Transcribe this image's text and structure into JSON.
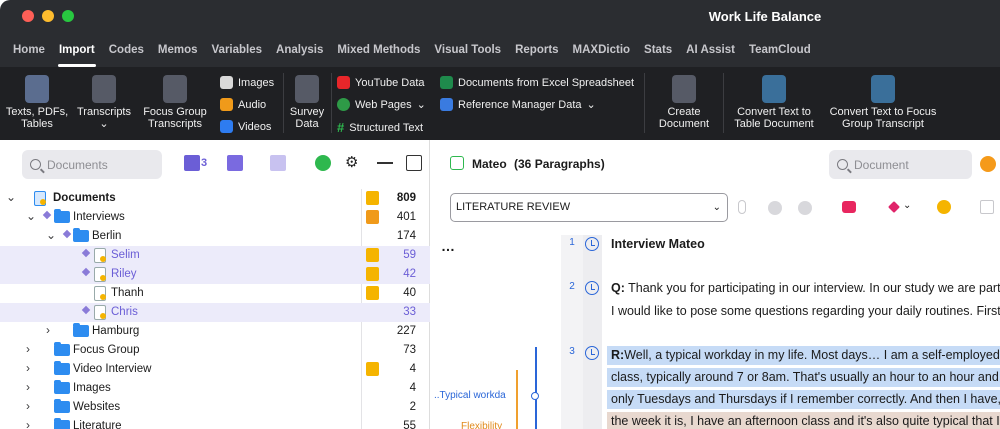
{
  "window": {
    "title": "Work Life Balance"
  },
  "menu": {
    "tabs": [
      "Home",
      "Import",
      "Codes",
      "Memos",
      "Variables",
      "Analysis",
      "Mixed Methods",
      "Visual Tools",
      "Reports",
      "MAXDictio",
      "Stats",
      "AI Assist",
      "TeamCloud"
    ],
    "active": "Import"
  },
  "ribbon": {
    "texts_pdfs": [
      "Texts, PDFs,",
      "Tables"
    ],
    "transcripts": "Transcripts",
    "focus_group": [
      "Focus Group",
      "Transcripts"
    ],
    "images": "Images",
    "audio": "Audio",
    "videos": "Videos",
    "survey": [
      "Survey",
      "Data"
    ],
    "youtube": "YouTube Data",
    "web_pages": "Web Pages",
    "structured_text": "Structured Text",
    "excel": "Documents from Excel Spreadsheet",
    "reference": "Reference Manager Data",
    "create_doc": [
      "Create",
      "Document"
    ],
    "convert_table": [
      "Convert Text to",
      "Table Document"
    ],
    "convert_focus": [
      "Convert Text to Focus",
      "Group Transcript"
    ]
  },
  "left": {
    "search_placeholder": "Documents",
    "set_count": "3",
    "tree": [
      {
        "label": "Documents",
        "count": "809"
      },
      {
        "label": "Interviews",
        "count": "401"
      },
      {
        "label": "Berlin",
        "count": "174"
      },
      {
        "label": "Selim",
        "count": "59"
      },
      {
        "label": "Riley",
        "count": "42"
      },
      {
        "label": "Thanh",
        "count": "40"
      },
      {
        "label": "Chris",
        "count": "33"
      },
      {
        "label": "Hamburg",
        "count": "227"
      },
      {
        "label": "Focus Group",
        "count": "73"
      },
      {
        "label": "Video Interview",
        "count": "4"
      },
      {
        "label": "Images",
        "count": "4"
      },
      {
        "label": "Websites",
        "count": "2"
      },
      {
        "label": "Literature",
        "count": "55"
      }
    ]
  },
  "right": {
    "doc_title": "Mateo",
    "doc_meta": "(36 Paragraphs)",
    "search_placeholder": "Document",
    "code_dropdown": "LITERATURE REVIEW",
    "codes": [
      "..Typical workda",
      "Flexibility"
    ],
    "paragraph_numbers": [
      "1",
      "2",
      "3"
    ],
    "lines": [
      "Interview Mateo",
      "Thank you for participating in our interview. In our study we are part",
      "I would like to pose some questions regarding your daily routines. First",
      "Well, a typical workday in my life. Most days… I am a self-employed",
      "class, typically around 7 or 8am. That's usually an hour to an hour and",
      "only Tuesdays and Thursdays if I remember correctly. And then I have,",
      "the week it is, I have an afternoon class and it's also quite typical that I"
    ],
    "speaker_q": "Q:",
    "speaker_r": "R:",
    "colors": {
      "highlight_blue": "#c6dbf6",
      "highlight_brown": "#e8d8cf",
      "accent": "#2a66d8"
    }
  }
}
